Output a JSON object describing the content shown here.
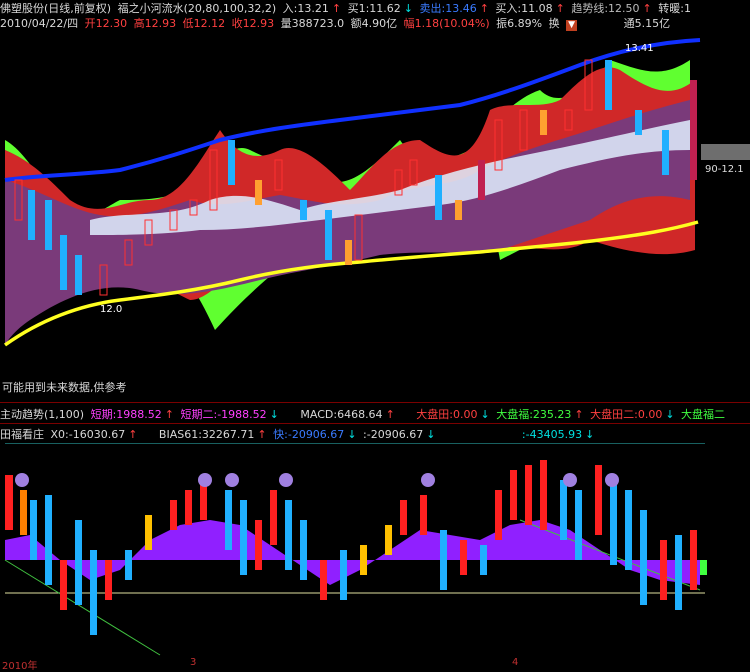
{
  "header": {
    "stock": "佛塑股份(日线,前复权)",
    "indicator": "福之小河流水(20,80,100,32,2)",
    "in_label": "入:13.21",
    "buy_label": "买1:11.62",
    "sell_out_label": "卖出:13.46",
    "buy_in_label": "买入:11.08",
    "trend_label": "趋势线:12.50",
    "turn_label": "转暖:1",
    "date": "2010/04/22/四",
    "open": "开12.30",
    "high": "高12.93",
    "low": "低12.12",
    "close": "收12.93",
    "volume": "量388723.0",
    "amount": "额4.90亿",
    "amplitude_change": "幅1.18(10.04%)",
    "swing": "振6.89%",
    "turnover": "换",
    "float": "通5.15亿"
  },
  "main_chart": {
    "peak_label": "13.41",
    "low_label": "12.0",
    "price_tag": "90-12.1",
    "warning": "可能用到未来数据,供参考"
  },
  "panel2": {
    "title": "主动趋势(1,100)",
    "short1": "短期:1988.52",
    "short2": "短期二:-1988.52",
    "macd": "MACD:6468.64",
    "dp1": "大盘田:0.00",
    "dp2": "大盘福:235.23",
    "dp3": "大盘田二:0.00",
    "dp4": "大盘福二"
  },
  "panel3": {
    "title": "田福看庄",
    "x0": "X0:-16030.67",
    "bias": "BIAS61:32267.71",
    "fast": "快:-20906.67",
    "val": ":-20906.67",
    "val2": ":-43405.93"
  },
  "axis": {
    "year": "2010年",
    "m3": "3",
    "m4": "4"
  },
  "colors": {
    "up": "#ff2020",
    "down": "#20b0ff",
    "ma_blue": "#1030ff",
    "ma_yellow": "#ffff20",
    "purple": "#8a3a8a",
    "green": "#60ff40"
  }
}
